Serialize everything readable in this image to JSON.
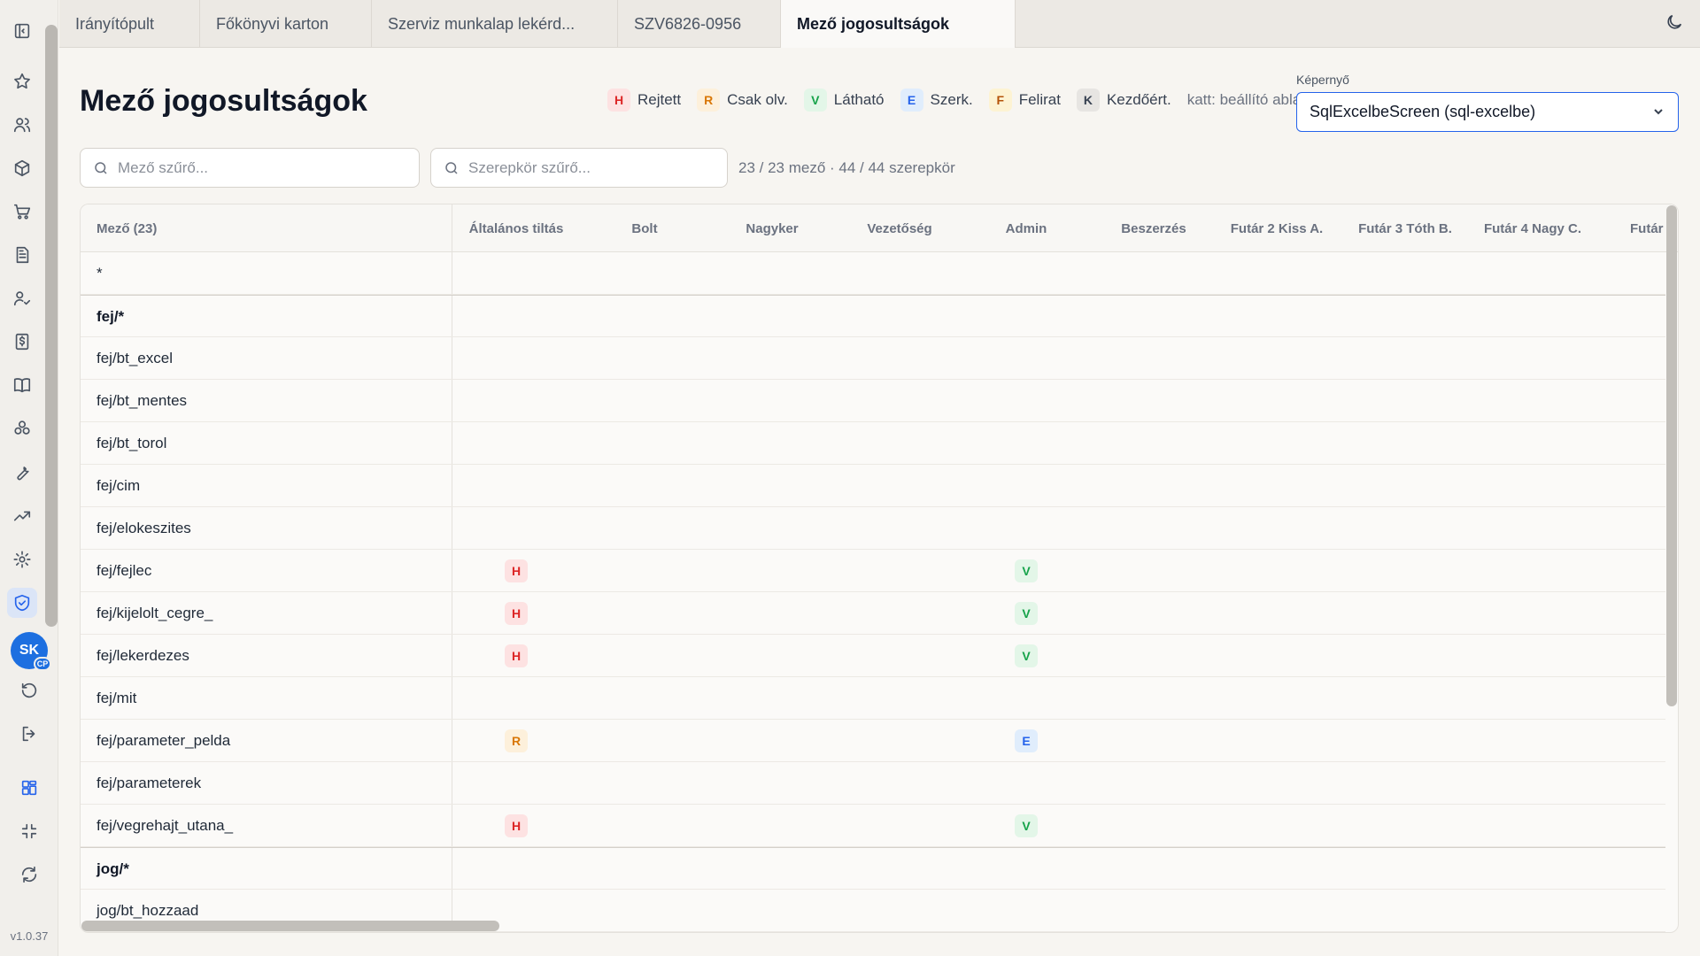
{
  "app": {
    "version": "v1.0.37",
    "user_initials": "SK",
    "user_badge": "CP"
  },
  "rail": {
    "icons": [
      "sidebar-toggle-icon",
      "star-icon",
      "users-icon",
      "box-icon",
      "cart-icon",
      "document-icon",
      "user-check-icon",
      "invoice-icon",
      "book-icon",
      "components-icon",
      "wrench-icon",
      "trend-icon",
      "gear-icon",
      "shield-check-icon",
      "history-icon",
      "logout-icon",
      "dashboard-grid-icon",
      "collapse-icon",
      "refresh-icon"
    ]
  },
  "tabs": [
    {
      "label": "Irányítópult",
      "active": false
    },
    {
      "label": "Főkönyvi karton",
      "active": false
    },
    {
      "label": "Szerviz munkalap lekérd...",
      "active": false
    },
    {
      "label": "SZV6826-0956",
      "active": false
    },
    {
      "label": "Mező jogosultságok",
      "active": true
    }
  ],
  "header": {
    "title": "Mező jogosultságok",
    "legend": [
      {
        "code": "H",
        "label": "Rejtett"
      },
      {
        "code": "R",
        "label": "Csak olv."
      },
      {
        "code": "V",
        "label": "Látható"
      },
      {
        "code": "E",
        "label": "Szerk."
      },
      {
        "code": "F",
        "label": "Felirat"
      },
      {
        "code": "K",
        "label": "Kezdőért."
      }
    ],
    "legend_hint": "katt: beállító ablak",
    "screen_label": "Képernyő",
    "screen_value": "SqlExcelbeScreen (sql-excelbe)"
  },
  "filters": {
    "field_placeholder": "Mező szűrő...",
    "role_placeholder": "Szerepkör szűrő...",
    "counts": "23 / 23 mező · 44 / 44 szerepkör"
  },
  "table": {
    "field_header": "Mező (23)",
    "roles": [
      "Általános tiltás",
      "Bolt",
      "Nagyker",
      "Vezetőség",
      "Admin",
      "Beszerzés",
      "Futár 2 Kiss A.",
      "Futár 3 Tóth B.",
      "Futár 4 Nagy C.",
      "Futár"
    ],
    "rows": [
      {
        "name": "*",
        "group": false,
        "cells": {}
      },
      {
        "name": "fej/*",
        "group": true,
        "cells": {}
      },
      {
        "name": "fej/bt_excel",
        "group": false,
        "cells": {}
      },
      {
        "name": "fej/bt_mentes",
        "group": false,
        "cells": {}
      },
      {
        "name": "fej/bt_torol",
        "group": false,
        "cells": {}
      },
      {
        "name": "fej/cim",
        "group": false,
        "cells": {}
      },
      {
        "name": "fej/elokeszites",
        "group": false,
        "cells": {}
      },
      {
        "name": "fej/fejlec",
        "group": false,
        "cells": {
          "0": "H",
          "4": "V"
        }
      },
      {
        "name": "fej/kijelolt_cegre_",
        "group": false,
        "cells": {
          "0": "H",
          "4": "V"
        }
      },
      {
        "name": "fej/lekerdezes",
        "group": false,
        "cells": {
          "0": "H",
          "4": "V"
        }
      },
      {
        "name": "fej/mit",
        "group": false,
        "cells": {}
      },
      {
        "name": "fej/parameter_pelda",
        "group": false,
        "cells": {
          "0": "R",
          "4": "E"
        }
      },
      {
        "name": "fej/parameterek",
        "group": false,
        "cells": {}
      },
      {
        "name": "fej/vegrehajt_utana_",
        "group": false,
        "cells": {
          "0": "H",
          "4": "V"
        }
      },
      {
        "name": "jog/*",
        "group": true,
        "cells": {}
      },
      {
        "name": "jog/bt_hozzaad",
        "group": false,
        "cells": {}
      }
    ]
  }
}
